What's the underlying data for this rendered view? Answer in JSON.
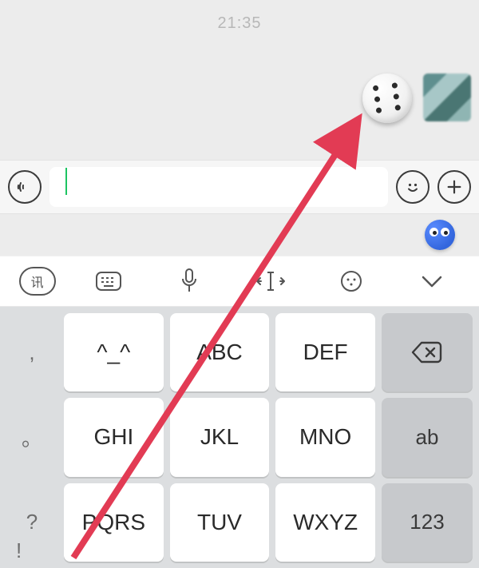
{
  "chat": {
    "timestamp": "21:35",
    "message_type": "dice",
    "dice_value": 6
  },
  "input_bar": {
    "voice_icon": "voice-waves-icon",
    "emoji_icon": "smile-icon",
    "plus_icon": "plus-icon",
    "text_value": "",
    "placeholder": ""
  },
  "floating": {
    "emoji_name": "eyes-emoji"
  },
  "keyboard_toolbar": {
    "items": [
      {
        "name": "ime-switch-icon",
        "label": "讯"
      },
      {
        "name": "keyboard-layout-icon",
        "label": "kbd"
      },
      {
        "name": "mic-icon",
        "label": "mic"
      },
      {
        "name": "cursor-move-icon",
        "label": "cursor"
      },
      {
        "name": "face-icon",
        "label": "face"
      },
      {
        "name": "collapse-icon",
        "label": "down"
      }
    ]
  },
  "keyboard": {
    "rows": [
      {
        "side": ",",
        "keys": [
          "^_^",
          "ABC",
          "DEF"
        ],
        "fn": "backspace"
      },
      {
        "side": "。",
        "keys": [
          "GHI",
          "JKL",
          "MNO"
        ],
        "fn": "ab"
      },
      {
        "side": "?",
        "keys": [
          "PQRS",
          "TUV",
          "WXYZ"
        ],
        "fn": "123"
      }
    ],
    "extra_side": "!"
  },
  "annotation": {
    "arrow_color": "#e23b54"
  }
}
